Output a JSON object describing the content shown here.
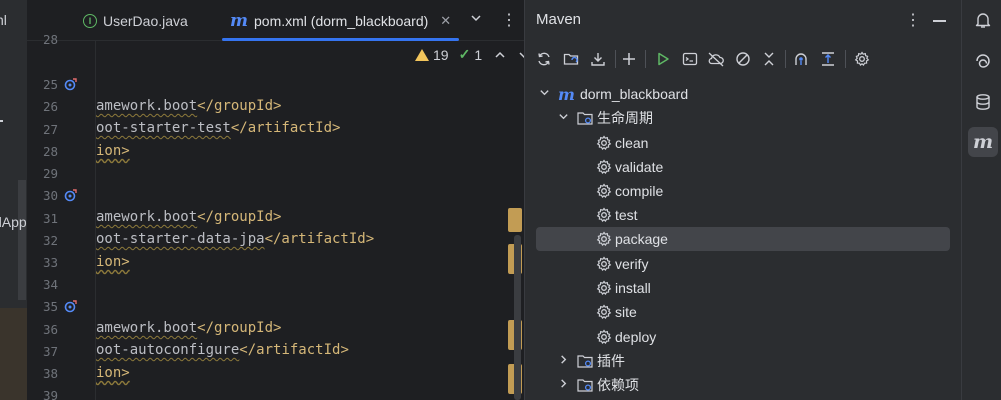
{
  "project_strip": {
    "tab_fragment": "nl",
    "app_fragment": "dApp"
  },
  "editor": {
    "tabs": [
      {
        "label": "UserDao.java",
        "icon": "java-class-icon",
        "active": false
      },
      {
        "label": "pom.xml (dorm_blackboard)",
        "icon": "maven-m-icon",
        "active": true
      }
    ],
    "close_glyph": "✕",
    "more_glyph": "⌄",
    "options_glyph": "⋮",
    "inspections": {
      "warnings": "19",
      "weak": "1"
    },
    "line_numbers": [
      "28",
      "29",
      "25",
      "26",
      "27",
      "28",
      "29",
      "30",
      "31",
      "32",
      "33",
      "34",
      "35",
      "36",
      "37",
      "38",
      "39"
    ],
    "code_lines": [
      {
        "pre": "amework.boot",
        "open": "</groupId>",
        "post": ""
      },
      {
        "pre": "oot-starter-test",
        "open": "</artifactId>",
        "post": ""
      },
      {
        "pre": "ion>",
        "open": "",
        "post": ""
      },
      {
        "pre": "amework.boot",
        "open": "</groupId>",
        "post": ""
      },
      {
        "pre": "oot-starter-data-jpa",
        "open": "</artifactId>",
        "post": ""
      },
      {
        "pre": "ion>",
        "open": "",
        "post": ""
      },
      {
        "pre": "amework.boot",
        "open": "</groupId>",
        "post": ""
      },
      {
        "pre": "oot-autoconfigure",
        "open": "</artifactId>",
        "post": ""
      },
      {
        "pre": "ion>",
        "open": "",
        "post": ""
      }
    ]
  },
  "maven": {
    "title": "Maven",
    "project": "dorm_blackboard",
    "lifecycle": "生命周期",
    "goals": [
      "clean",
      "validate",
      "compile",
      "test",
      "package",
      "verify",
      "install",
      "site",
      "deploy"
    ],
    "selected_goal": "package",
    "plugins": "插件",
    "dependencies": "依赖项"
  },
  "colors": {
    "accent": "#3574f0",
    "maven_blue": "#548af7",
    "xml_tag": "#d5b778",
    "warning": "#f2c55c",
    "ok_green": "#5fb865",
    "run_green": "#5fb865"
  }
}
